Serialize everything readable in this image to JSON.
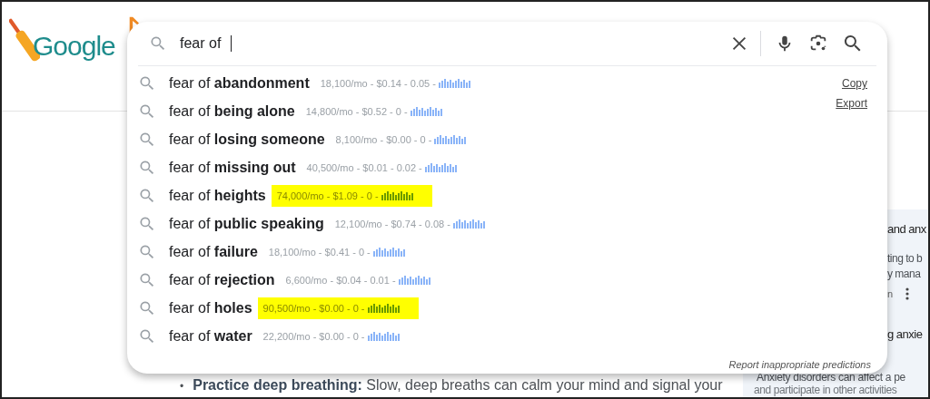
{
  "logo": {
    "text": "Google"
  },
  "search": {
    "value": "fear of "
  },
  "suggestions": [
    {
      "text": "fear of **abandonment**",
      "metrics": "18,100/mo - $0.14 - 0.05 -",
      "highlighted": false
    },
    {
      "text": "fear of **being alone**",
      "metrics": "14,800/mo - $0.52 - 0 -",
      "highlighted": false
    },
    {
      "text": "fear of **losing someone**",
      "metrics": "8,100/mo - $0.00 - 0 -",
      "highlighted": false
    },
    {
      "text": "fear of **missing out**",
      "metrics": "40,500/mo - $0.01 - 0.02 -",
      "highlighted": false
    },
    {
      "text": "fear of **heights**",
      "metrics": "74,000/mo - $1.09 - 0 -",
      "highlighted": true
    },
    {
      "text": "fear of **public speaking**",
      "metrics": "12,100/mo - $0.74 - 0.08 -",
      "highlighted": false
    },
    {
      "text": "fear of **failure**",
      "metrics": "18,100/mo - $0.41 - 0 -",
      "highlighted": false
    },
    {
      "text": "fear of **rejection**",
      "metrics": "6,600/mo - $0.04 - 0.01 -",
      "highlighted": false
    },
    {
      "text": "fear of **holes**",
      "metrics": "90,500/mo - $0.00 - 0 -",
      "highlighted": true
    },
    {
      "text": "fear of **water**",
      "metrics": "22,200/mo - $0.00 - 0 -",
      "highlighted": false
    }
  ],
  "actions": [
    "Copy",
    "Export"
  ],
  "report_link": "Report inappropriate predictions",
  "side_card": {
    "lines": [
      "and anx",
      "ting to b",
      "y mana",
      "n"
    ],
    "heading": "g anxie",
    "text": [
      "Anxiety disorders can affect a pe",
      "and participate in other activities"
    ]
  },
  "bullet": {
    "marker": "•",
    "text": "**Practice deep breathing:** Slow, deep breaths can calm your mind and signal your"
  }
}
